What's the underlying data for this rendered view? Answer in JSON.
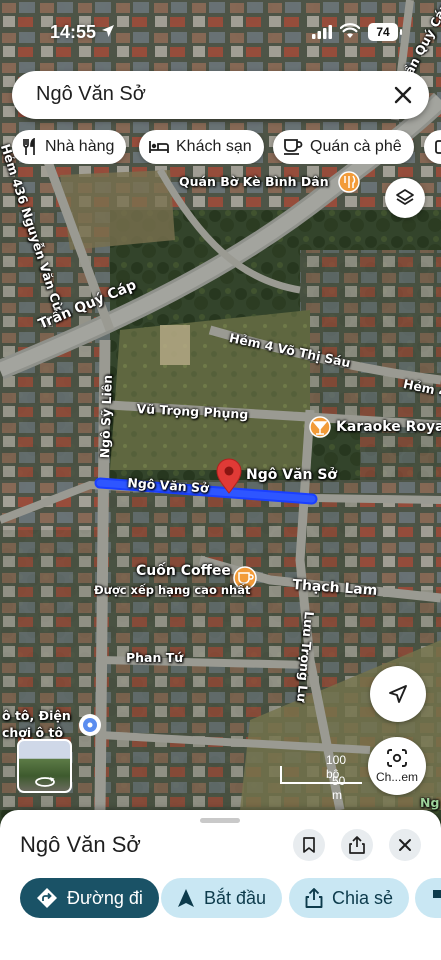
{
  "status_bar": {
    "time": "14:55",
    "battery": "74"
  },
  "search": {
    "query": "Ngô Văn Sở"
  },
  "chips": [
    {
      "label": "Nhà hàng",
      "icon": "restaurant-icon"
    },
    {
      "label": "Khách sạn",
      "icon": "hotel-icon"
    },
    {
      "label": "Quán cà phê",
      "icon": "cafe-icon"
    }
  ],
  "map_labels": {
    "poi_restaurant": "Quán Bờ Kè Bình Dân",
    "street_hem436": "Hẻm 436 Nguyễn Văn Cừ",
    "street_tran_quy_cap": "Trần Quý Cáp",
    "street_tran_quy_cap_top": "Trần Quý Cáp",
    "street_hem4": "Hẻm 4 Võ Thị Sáu",
    "street_hem_right": "Hẻm 4",
    "street_vu_trong_phung": "Vũ Trọng Phụng",
    "poi_karaoke": "Karaoke Royal",
    "street_ngo_sy_lien": "Ngô Sỹ Liên",
    "street_ngo_van_so": "Ngô Văn Sở",
    "pin_label": "Ngô Văn Sở",
    "poi_cafe": "Cuốn Coffee",
    "poi_cafe_sub": "Được xếp hạng cao nhất",
    "street_thach_lam": "Thạch Lam",
    "street_luu_trong_lu": "Lưu Trọng Lư",
    "street_phan_tu": "Phan Tứ",
    "poi_left1": "ô tô, Điện",
    "poi_left2": "chợi ô tô",
    "poi_right_edge": "Ng"
  },
  "scale": {
    "top": "100 bộ",
    "bottom": "50 m"
  },
  "lens_label": "Ch...em",
  "sheet": {
    "title": "Ngô Văn Sở",
    "actions": [
      {
        "label": "Đường đi",
        "icon": "directions-icon"
      },
      {
        "label": "Bắt đầu",
        "icon": "navigation-arrow-icon"
      },
      {
        "label": "Chia sẻ",
        "icon": "share-icon"
      }
    ]
  },
  "colors": {
    "accent": "#1a5266",
    "secondary": "#c9e7f3",
    "route": "#1a3fff",
    "pin": "#e03a36"
  }
}
